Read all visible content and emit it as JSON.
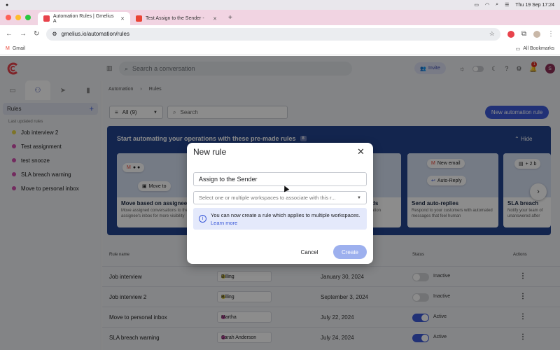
{
  "menubar": {
    "datetime": "Thu 19 Sep  17:24"
  },
  "browser": {
    "tabs": [
      {
        "title": "Automation Rules | Gmelius A",
        "active": true
      },
      {
        "title": "Test Assign to the Sender - ",
        "active": false
      }
    ],
    "url": "gmelius.io/automation/rules",
    "bookmark": "Gmail",
    "all_bookmarks": "All Bookmarks"
  },
  "header": {
    "search_placeholder": "Search a conversation",
    "invite_label": "Invite",
    "notification_count": "1",
    "avatar_initial": "S"
  },
  "sidebar": {
    "rules_label": "Rules",
    "last_updated_label": "Last updated rules",
    "items": [
      {
        "label": "Job interview 2",
        "color": "#e5d44a"
      },
      {
        "label": "Test assignment",
        "color": "#d24fae"
      },
      {
        "label": "test snooze",
        "color": "#d24fae"
      },
      {
        "label": "SLA breach warning",
        "color": "#d24fae"
      },
      {
        "label": "Move to personal inbox",
        "color": "#d24fae"
      }
    ]
  },
  "main": {
    "breadcrumb": [
      "Automation",
      "Rules"
    ],
    "filter_label": "All (9)",
    "search_placeholder": "Search",
    "new_rule_button": "New automation rule",
    "banner": {
      "title": "Start automating your operations with these pre-made rules",
      "count": "8",
      "hide_label": "Hide",
      "cards": [
        {
          "title": "Move based on assignee",
          "desc": "Move assigned conversations to the assignee's inbox for more visibility",
          "pill1": "Move to",
          "pill2": "i"
        },
        {
          "title": "ds",
          "desc": "ation",
          "pill1": "",
          "pill2": ""
        },
        {
          "title": "Send auto-replies",
          "desc": "Respond to your customers with automated messages that feel human",
          "pill1": "New email",
          "pill2": "Auto-Reply"
        },
        {
          "title": "SLA breach",
          "desc": "Notify your team of unanswered after",
          "pill1": "+ 2 b",
          "pill2": ""
        }
      ]
    },
    "table": {
      "headers": {
        "name": "Rule name",
        "status": "Status",
        "actions": "Actions"
      },
      "rows": [
        {
          "name": "Job interview",
          "chip": "Billing",
          "chip_color": "#e5d44a",
          "date": "January 30, 2024",
          "status": "Inactive",
          "on": false
        },
        {
          "name": "Job interview 2",
          "chip": "Billing",
          "chip_color": "#e5d44a",
          "date": "September 3, 2024",
          "status": "Inactive",
          "on": false
        },
        {
          "name": "Move to personal inbox",
          "chip": "Martha",
          "chip_color": "#d24fae",
          "date": "July 22, 2024",
          "status": "Active",
          "on": true
        },
        {
          "name": "SLA breach warning",
          "chip": "Sarah Anderson",
          "chip_color": "#d24fae",
          "date": "July 24, 2024",
          "status": "Active",
          "on": true
        }
      ]
    }
  },
  "modal": {
    "title": "New rule",
    "name_value": "Assign to the Sender",
    "workspace_placeholder": "Select one or multiple workspaces to associate with this r...",
    "info_text": "You can now create a rule which applies to multiple workspaces.",
    "info_link": "Learn more",
    "cancel_label": "Cancel",
    "create_label": "Create"
  },
  "colors": {
    "accent": "#3c5ad8",
    "banner": "#23448e"
  }
}
